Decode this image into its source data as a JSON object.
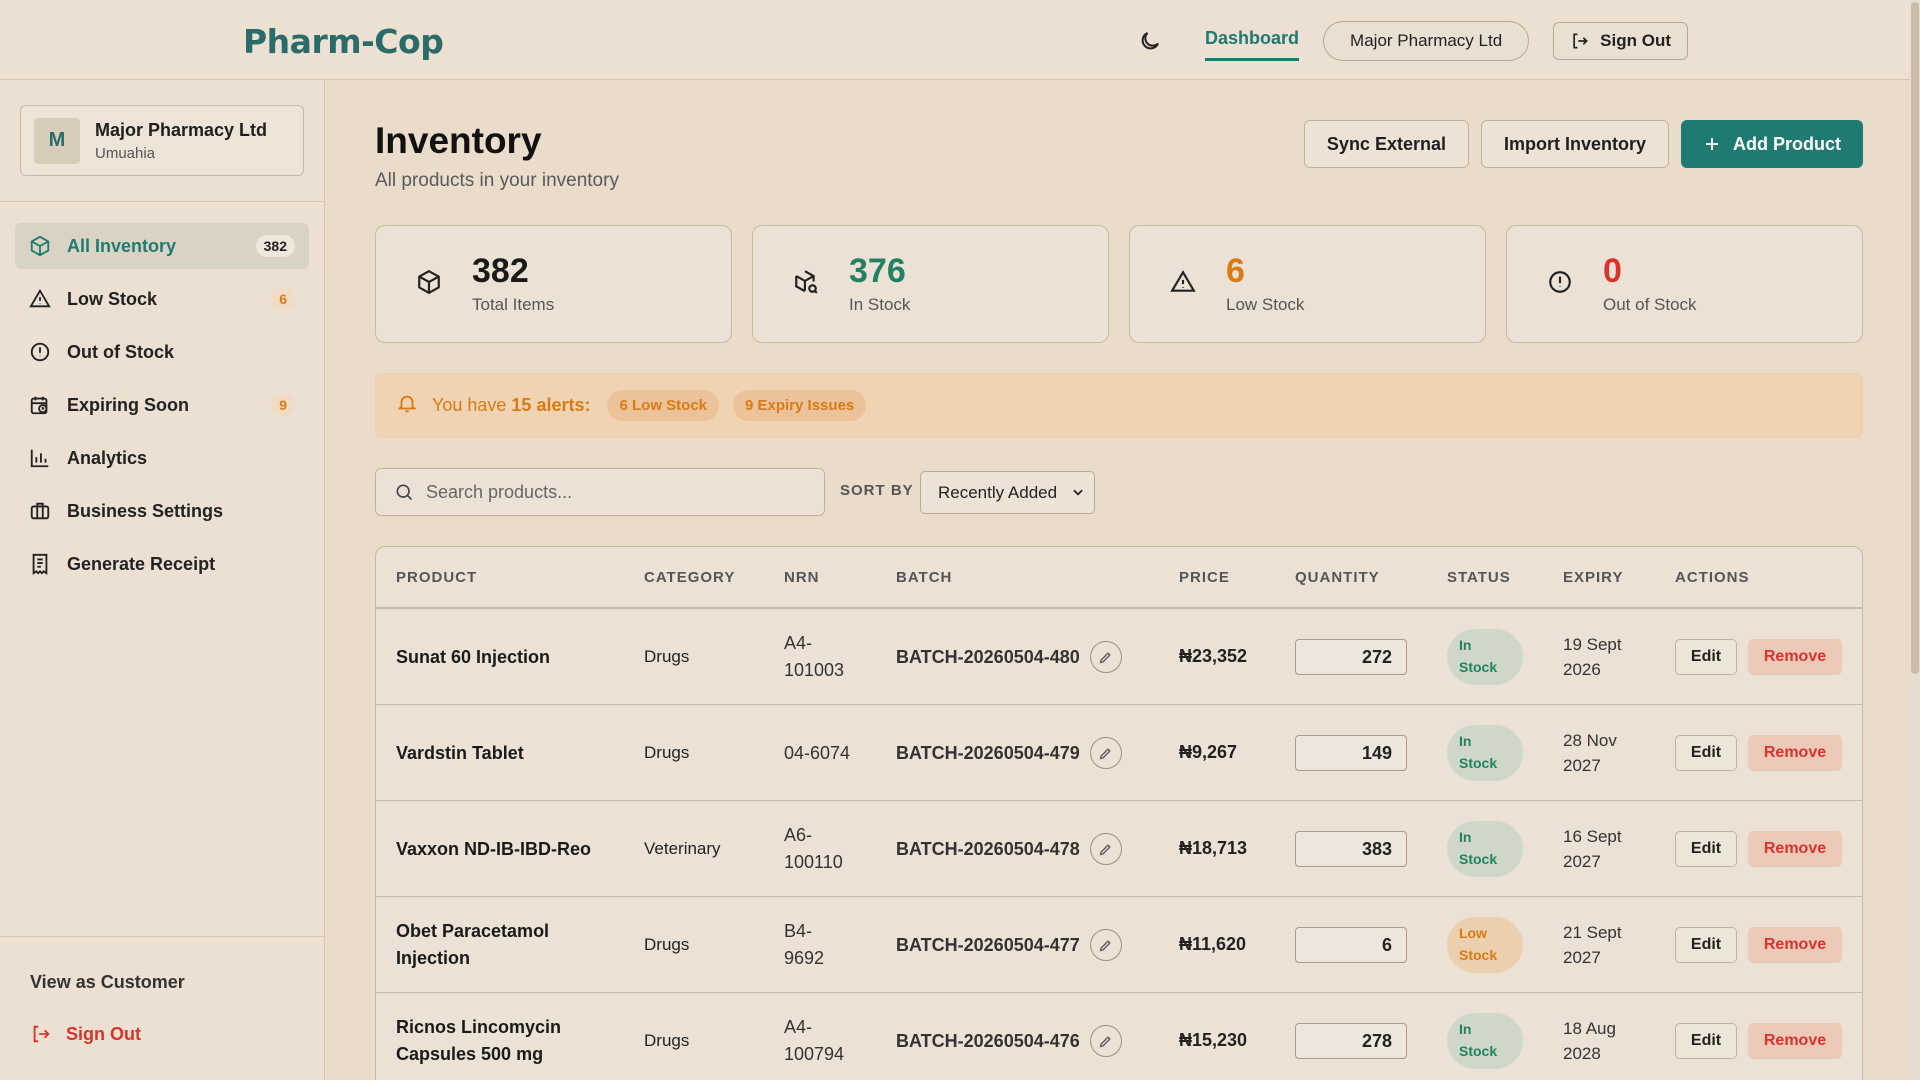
{
  "header": {
    "logo": "Pharm-Cop",
    "nav_dashboard": "Dashboard",
    "org_pill": "Major Pharmacy Ltd",
    "sign_out": "Sign Out"
  },
  "sidebar": {
    "org": {
      "initial": "M",
      "name": "Major Pharmacy Ltd",
      "city": "Umuahia"
    },
    "items": [
      {
        "label": "All Inventory",
        "badge": "382",
        "icon": "box-icon",
        "active": true
      },
      {
        "label": "Low Stock",
        "badge": "6",
        "icon": "warning-triangle-icon"
      },
      {
        "label": "Out of Stock",
        "badge": "",
        "icon": "alert-circle-icon"
      },
      {
        "label": "Expiring Soon",
        "badge": "9",
        "icon": "calendar-clock-icon"
      },
      {
        "label": "Analytics",
        "badge": "",
        "icon": "bar-chart-icon"
      },
      {
        "label": "Business Settings",
        "badge": "",
        "icon": "briefcase-icon"
      },
      {
        "label": "Generate Receipt",
        "badge": "",
        "icon": "receipt-icon"
      }
    ],
    "view_as_customer": "View as Customer",
    "sign_out": "Sign Out"
  },
  "main": {
    "title": "Inventory",
    "subtitle": "All products in your inventory",
    "actions": {
      "sync": "Sync External",
      "import": "Import Inventory",
      "add": "Add Product"
    },
    "stats": [
      {
        "value": "382",
        "label": "Total Items",
        "color": "#1a1a1a",
        "icon": "box-icon"
      },
      {
        "value": "376",
        "label": "In Stock",
        "color": "#228063",
        "icon": "box-search-icon"
      },
      {
        "value": "6",
        "label": "Low Stock",
        "color": "#d97b14",
        "icon": "warning-triangle-icon"
      },
      {
        "value": "0",
        "label": "Out of Stock",
        "color": "#d9342b",
        "icon": "alert-circle-icon"
      }
    ],
    "alert": {
      "prefix": "You have ",
      "count": "15 alerts:",
      "chip_low": "6 Low Stock",
      "chip_expiry": "9 Expiry Issues"
    },
    "search_placeholder": "Search products...",
    "sort_label": "SORT BY",
    "sort_value": "Recently Added",
    "columns": [
      "PRODUCT",
      "CATEGORY",
      "NRN",
      "BATCH",
      "PRICE",
      "QUANTITY",
      "STATUS",
      "EXPIRY",
      "ACTIONS"
    ],
    "rows": [
      {
        "product": [
          "Sunat 60 Injection"
        ],
        "category": "Drugs",
        "nrn": [
          "A4-",
          "101003"
        ],
        "batch": "BATCH-20260504-480",
        "price": "₦23,352",
        "qty": "272",
        "status": [
          "In",
          "Stock"
        ],
        "status_type": "in",
        "expiry": [
          "19 Sept",
          "2026"
        ]
      },
      {
        "product": [
          "Vardstin Tablet"
        ],
        "category": "Drugs",
        "nrn": [
          "04-6074"
        ],
        "batch": "BATCH-20260504-479",
        "price": "₦9,267",
        "qty": "149",
        "status": [
          "In",
          "Stock"
        ],
        "status_type": "in",
        "expiry": [
          "28 Nov",
          "2027"
        ]
      },
      {
        "product": [
          "Vaxxon ND-IB-IBD-Reo"
        ],
        "category": "Veterinary",
        "nrn": [
          "A6-",
          "100110"
        ],
        "batch": "BATCH-20260504-478",
        "price": "₦18,713",
        "qty": "383",
        "status": [
          "In",
          "Stock"
        ],
        "status_type": "in",
        "expiry": [
          "16 Sept",
          "2027"
        ]
      },
      {
        "product": [
          "Obet Paracetamol",
          "Injection"
        ],
        "category": "Drugs",
        "nrn": [
          "B4-",
          "9692"
        ],
        "batch": "BATCH-20260504-477",
        "price": "₦11,620",
        "qty": "6",
        "status": [
          "Low",
          "Stock"
        ],
        "status_type": "low",
        "expiry": [
          "21 Sept",
          "2027"
        ]
      },
      {
        "product": [
          "Ricnos Lincomycin",
          "Capsules 500 mg"
        ],
        "category": "Drugs",
        "nrn": [
          "A4-",
          "100794"
        ],
        "batch": "BATCH-20260504-476",
        "price": "₦15,230",
        "qty": "278",
        "status": [
          "In",
          "Stock"
        ],
        "status_type": "in",
        "expiry": [
          "18 Aug",
          "2028"
        ]
      }
    ],
    "edit_label": "Edit",
    "remove_label": "Remove"
  }
}
